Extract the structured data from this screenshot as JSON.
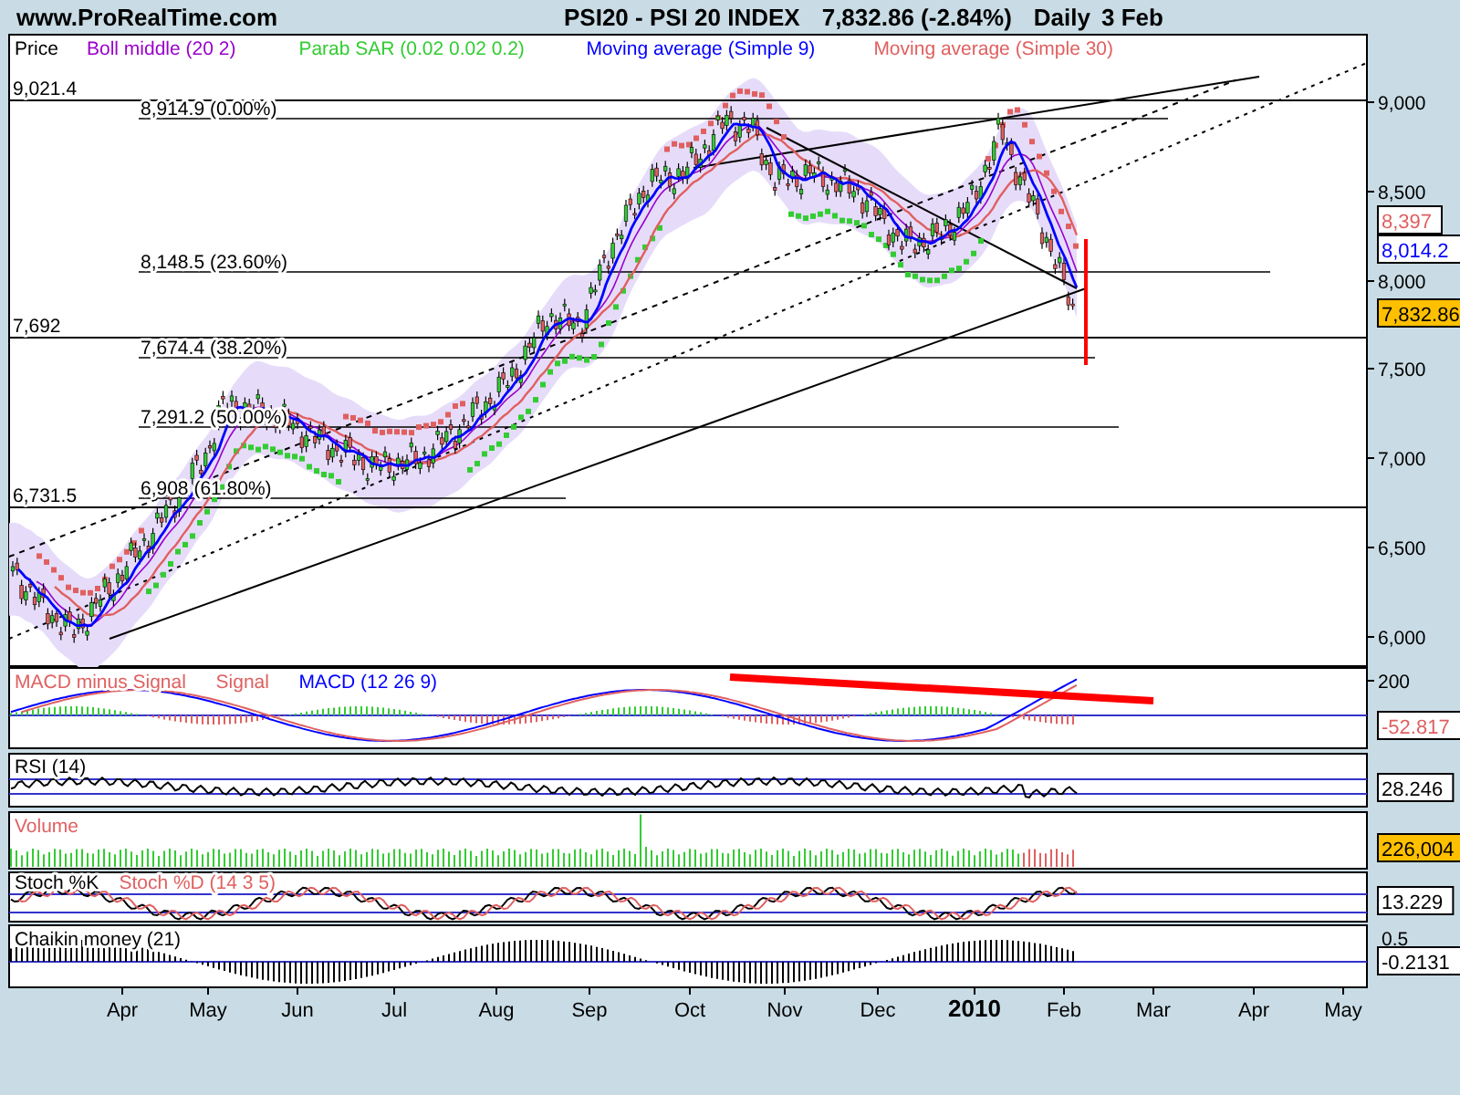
{
  "header": {
    "site": "www.ProRealTime.com",
    "title": "PSI20 - PSI 20 INDEX",
    "quote": "7,832.86 (-2.84%)",
    "period": "Daily",
    "date": "3 Feb"
  },
  "price_panel": {
    "legend": [
      {
        "label": "Price",
        "color": "#000000"
      },
      {
        "label": "Boll middle (20 2)",
        "color": "#9900cc"
      },
      {
        "label": "Parab SAR (0.02 0.02 0.2)",
        "color": "#33cc33"
      },
      {
        "label": "Moving average (Simple 9)",
        "color": "#0000ff"
      },
      {
        "label": "Moving average (Simple 30)",
        "color": "#e06060"
      }
    ],
    "levels": [
      {
        "label": "9,021.4"
      },
      {
        "label": "7,692"
      },
      {
        "label": "6,731.5"
      }
    ],
    "fibonacci": [
      {
        "label": "8,914.9 (0.00%)"
      },
      {
        "label": "8,148.5 (23.60%)"
      },
      {
        "label": "7,674.4 (38.20%)"
      },
      {
        "label": "7,291.2 (50.00%)"
      },
      {
        "label": "6,908 (61.80%)"
      }
    ],
    "yticks": [
      "9,000",
      "8,500",
      "8,000",
      "7,500",
      "7,000",
      "6,500",
      "6,000"
    ],
    "readings": [
      {
        "text": "8,397",
        "color": "#e06060",
        "kind": "line"
      },
      {
        "text": "8,014.2",
        "color": "#0000ff",
        "kind": "line"
      },
      {
        "text": "7,832.86",
        "color": "#000000",
        "kind": "last"
      }
    ]
  },
  "macd": {
    "legend": [
      {
        "label": "MACD minus Signal",
        "color": "#e06060"
      },
      {
        "label": "Signal",
        "color": "#e06060"
      },
      {
        "label": "MACD (12 26 9)",
        "color": "#0000ff"
      }
    ],
    "ytick": "200",
    "reading": {
      "text": "-52.817",
      "color": "#e06060"
    }
  },
  "rsi": {
    "label": "RSI (14)",
    "reading": {
      "text": "28.246",
      "color": "#000000"
    }
  },
  "volume": {
    "label": "Volume",
    "reading": {
      "text": "226,004",
      "color": "#000000",
      "kind": "last"
    }
  },
  "stochastic": {
    "legend": [
      {
        "label": "Stoch %K",
        "color": "#000000"
      },
      {
        "label": "Stoch %D (14 3 5)",
        "color": "#e06060"
      }
    ],
    "reading": {
      "text": "13.229",
      "color": "#000000"
    }
  },
  "chaikin": {
    "label": "Chaikin money (21)",
    "ytick": "0.5",
    "reading": {
      "text": "-0.2131",
      "color": "#000000"
    }
  },
  "months": [
    {
      "label": "Apr",
      "bold": false
    },
    {
      "label": "May",
      "bold": false
    },
    {
      "label": "Jun",
      "bold": false
    },
    {
      "label": "Jul",
      "bold": false
    },
    {
      "label": "Aug",
      "bold": false
    },
    {
      "label": "Sep",
      "bold": false
    },
    {
      "label": "Oct",
      "bold": false
    },
    {
      "label": "Nov",
      "bold": false
    },
    {
      "label": "Dec",
      "bold": false
    },
    {
      "label": "2010",
      "bold": true
    },
    {
      "label": "Feb",
      "bold": false
    },
    {
      "label": "Mar",
      "bold": false
    },
    {
      "label": "Apr",
      "bold": false
    },
    {
      "label": "May",
      "bold": false
    }
  ]
}
